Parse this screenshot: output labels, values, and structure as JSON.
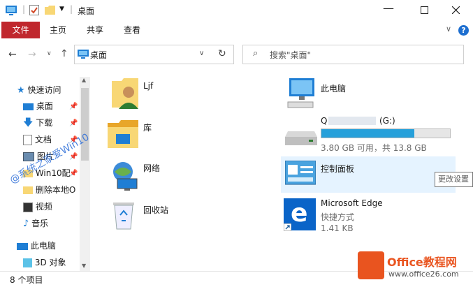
{
  "window": {
    "title": "桌面"
  },
  "ribbon": {
    "tabs": [
      "文件",
      "主页",
      "共享",
      "查看"
    ]
  },
  "address": {
    "path": "桌面",
    "search_placeholder": "搜索\"桌面\""
  },
  "nav": {
    "quick_access": "快速访问",
    "items": [
      {
        "label": "桌面",
        "pinned": true
      },
      {
        "label": "下载",
        "pinned": true
      },
      {
        "label": "文档",
        "pinned": true
      },
      {
        "label": "图片",
        "pinned": true
      },
      {
        "label": "Win10配",
        "pinned": true
      },
      {
        "label": "删除本地O",
        "pinned": false
      },
      {
        "label": "视频",
        "pinned": false
      },
      {
        "label": "音乐",
        "pinned": false
      }
    ],
    "this_pc": "此电脑",
    "objects_3d": "3D 对象"
  },
  "files": {
    "left": [
      {
        "name": "Ljf",
        "icon": "user-folder-icon"
      },
      {
        "name": "库",
        "icon": "library-icon"
      },
      {
        "name": "网络",
        "icon": "network-icon"
      },
      {
        "name": "回收站",
        "icon": "recycle-bin-icon"
      }
    ],
    "this_pc": "此电脑",
    "drive": {
      "name": "(G:)",
      "name_prefix": "Q",
      "free_text": "3.80 GB 可用，共 13.8 GB",
      "used_fraction": 0.725
    },
    "control_panel": "控制面板",
    "edge": {
      "name": "Microsoft Edge",
      "type": "快捷方式",
      "size": "1.41 KB"
    }
  },
  "tooltip": "更改设置",
  "status": {
    "count": "8 个项目"
  },
  "watermark": "@系统之家爱Win10",
  "logo": {
    "name": "Office教程网",
    "url": "www.office26.com"
  },
  "colors": {
    "file_tab": "#c0272d",
    "drive_bar": "#26a0da",
    "selection": "#e5f3ff"
  }
}
